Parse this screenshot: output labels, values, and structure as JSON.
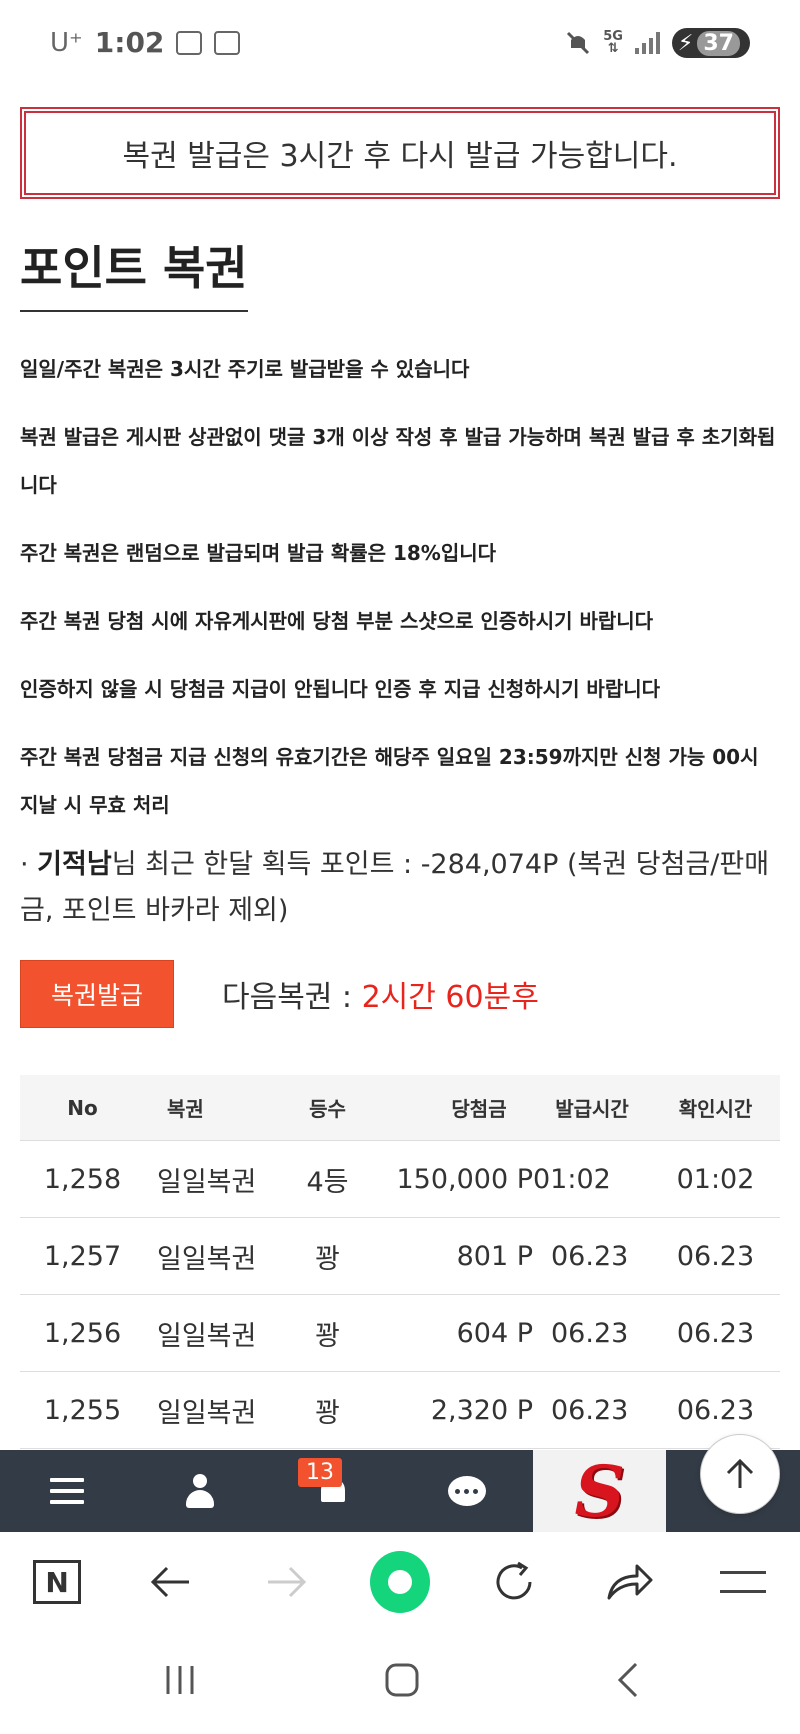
{
  "status_bar": {
    "carrier": "U⁺",
    "time": "1:02",
    "network": "5G",
    "battery": "37"
  },
  "notice": {
    "text": "복권 발급은 3시간 후 다시 발급 가능합니다."
  },
  "page": {
    "title": "포인트 복권"
  },
  "rules": [
    "일일/주간 복권은 3시간 주기로 발급받을 수 있습니다",
    "복권 발급은 게시판 상관없이 댓글 3개 이상 작성 후 발급 가능하며 복권 발급 후 초기화됩니다",
    "주간 복권은 랜덤으로 발급되며 발급 확률은 18%입니다",
    "주간 복권 당첨 시에 자유게시판에 당첨 부분 스샷으로 인증하시기 바랍니다",
    "인증하지 않을 시 당첨금 지급이 안됩니다 인증 후 지급 신청하시기 바랍니다",
    "주간 복권 당첨금 지급 신청의 유효기간은 해당주 일요일 23:59까지만 신청 가능 00시 지날 시 무효 처리"
  ],
  "points": {
    "prefix": "· ",
    "username": "기적남",
    "text": "님 최근 한달 획득 포인트 : -284,074P (복권 당첨금/판매금, 포인트 바카라 제외)"
  },
  "issue": {
    "button_label": "복권발급",
    "next_label": "다음복권 : ",
    "next_value": "2시간 60분후"
  },
  "table": {
    "headers": {
      "no": "No",
      "name": "복권",
      "grade": "등수",
      "amount": "당첨금",
      "issued": "발급시간",
      "checked": "확인시간"
    },
    "rows": [
      {
        "no": "1,258",
        "name": "일일복권",
        "grade": "4등",
        "amount": "150,000 P",
        "issued": "01:02",
        "checked": "01:02"
      },
      {
        "no": "1,257",
        "name": "일일복권",
        "grade": "꽝",
        "amount": "801 P",
        "issued": "06.23",
        "checked": "06.23"
      },
      {
        "no": "1,256",
        "name": "일일복권",
        "grade": "꽝",
        "amount": "604 P",
        "issued": "06.23",
        "checked": "06.23"
      },
      {
        "no": "1,255",
        "name": "일일복권",
        "grade": "꽝",
        "amount": "2,320 P",
        "issued": "06.23",
        "checked": "06.23"
      }
    ]
  },
  "site_nav": {
    "notification_count": "13",
    "logo_letter": "S"
  },
  "colors": {
    "accent": "#f2522e",
    "notice_border": "#c8313d",
    "next_value": "#e8241c",
    "nav_bg": "#333b46",
    "naver_green": "#14d47c"
  }
}
